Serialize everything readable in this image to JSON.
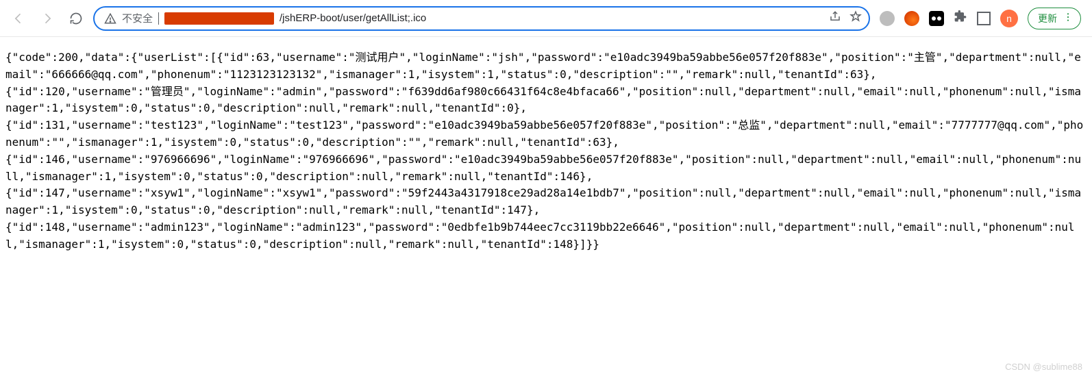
{
  "toolbar": {
    "insecure_label": "不安全",
    "url_path": "/jshERP-boot/user/getAllList;.ico",
    "update_label": "更新",
    "avatar_letter": "n"
  },
  "body_text": "{\"code\":200,\"data\":{\"userList\":[{\"id\":63,\"username\":\"测试用户\",\"loginName\":\"jsh\",\"password\":\"e10adc3949ba59abbe56e057f20f883e\",\"position\":\"主管\",\"department\":null,\"email\":\"666666@qq.com\",\"phonenum\":\"1123123123132\",\"ismanager\":1,\"isystem\":1,\"status\":0,\"description\":\"\",\"remark\":null,\"tenantId\":63},\n{\"id\":120,\"username\":\"管理员\",\"loginName\":\"admin\",\"password\":\"f639dd6af980c66431f64c8e4bfaca66\",\"position\":null,\"department\":null,\"email\":null,\"phonenum\":null,\"ismanager\":1,\"isystem\":0,\"status\":0,\"description\":null,\"remark\":null,\"tenantId\":0},\n{\"id\":131,\"username\":\"test123\",\"loginName\":\"test123\",\"password\":\"e10adc3949ba59abbe56e057f20f883e\",\"position\":\"总监\",\"department\":null,\"email\":\"7777777@qq.com\",\"phonenum\":\"\",\"ismanager\":1,\"isystem\":0,\"status\":0,\"description\":\"\",\"remark\":null,\"tenantId\":63},\n{\"id\":146,\"username\":\"976966696\",\"loginName\":\"976966696\",\"password\":\"e10adc3949ba59abbe56e057f20f883e\",\"position\":null,\"department\":null,\"email\":null,\"phonenum\":null,\"ismanager\":1,\"isystem\":0,\"status\":0,\"description\":null,\"remark\":null,\"tenantId\":146},\n{\"id\":147,\"username\":\"xsyw1\",\"loginName\":\"xsyw1\",\"password\":\"59f2443a4317918ce29ad28a14e1bdb7\",\"position\":null,\"department\":null,\"email\":null,\"phonenum\":null,\"ismanager\":1,\"isystem\":0,\"status\":0,\"description\":null,\"remark\":null,\"tenantId\":147},\n{\"id\":148,\"username\":\"admin123\",\"loginName\":\"admin123\",\"password\":\"0edbfe1b9b744eec7cc3119bb22e6646\",\"position\":null,\"department\":null,\"email\":null,\"phonenum\":null,\"ismanager\":1,\"isystem\":0,\"status\":0,\"description\":null,\"remark\":null,\"tenantId\":148}]}}",
  "watermark": "CSDN @sublime88"
}
